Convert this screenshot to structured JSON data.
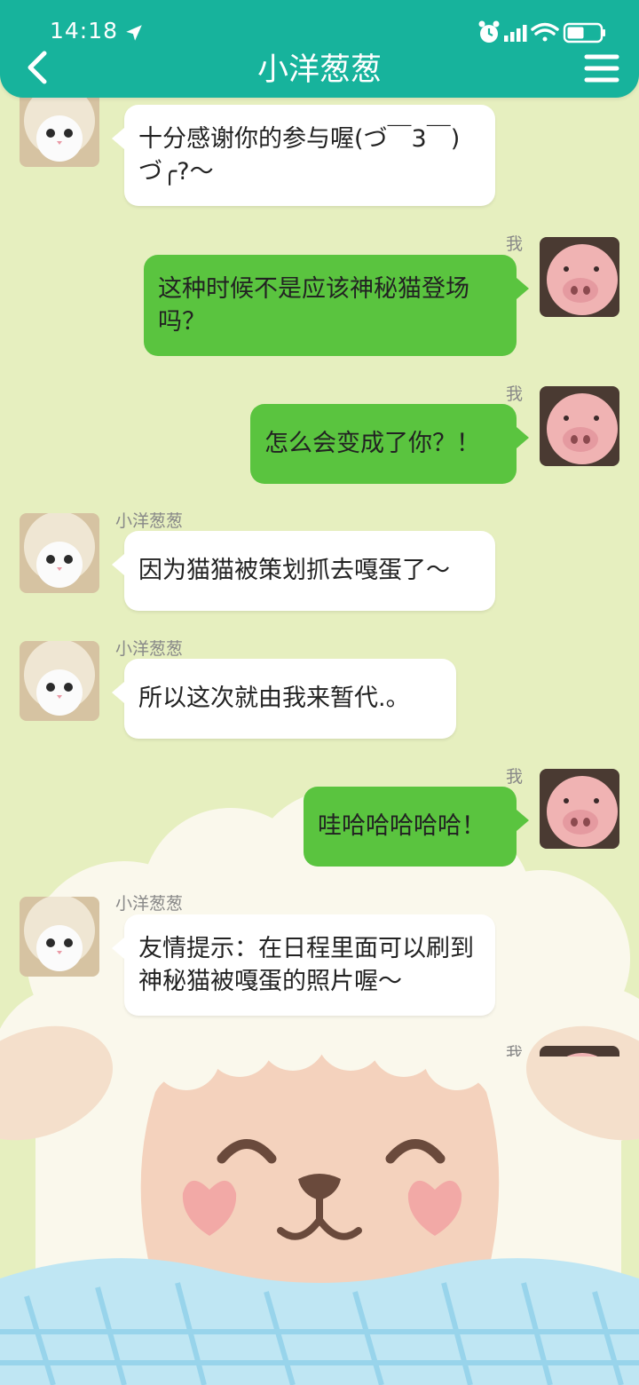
{
  "status_bar": {
    "time": "14:18"
  },
  "header": {
    "title": "小洋葱葱"
  },
  "messages": [
    {
      "text": "十分感谢你的参与喔(づ￣3￣)づ╭?～",
      "sender": ""
    },
    {
      "text": "这种时候不是应该神秘猫登场吗？",
      "sender": "我"
    },
    {
      "text": "怎么会变成了你？！",
      "sender": "我"
    },
    {
      "text": "因为猫猫被策划抓去嘎蛋了～",
      "sender": "小洋葱葱"
    },
    {
      "text": "所以这次就由我来暂代.。",
      "sender": "小洋葱葱"
    },
    {
      "text": "哇哈哈哈哈哈！",
      "sender": "我"
    },
    {
      "text": "友情提示：在日程里面可以刷到神秘猫被嘎蛋的照片喔～",
      "sender": "小洋葱葱"
    },
    {
      "text": "",
      "sender": "我"
    }
  ],
  "colors": {
    "header": "#17b39c",
    "background": "#e6efbf",
    "own_bubble": "#5ac43f",
    "other_bubble": "#ffffff"
  }
}
